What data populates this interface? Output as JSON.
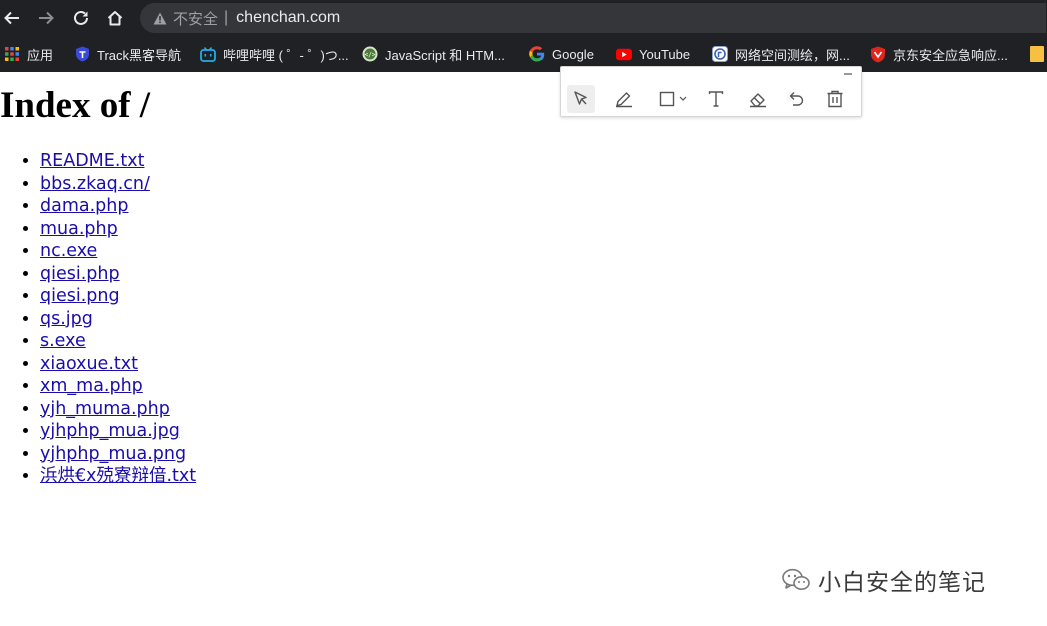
{
  "browser": {
    "url_warning": "不安全",
    "url_separator": "|",
    "url": "chenchan.com"
  },
  "bookmarks": [
    {
      "label": "应用",
      "icon": "apps-grid-icon"
    },
    {
      "label": "Track黑客导航",
      "icon": "shield-badge-icon"
    },
    {
      "label": "哔哩哔哩 ( ゜- ゜)つ...",
      "icon": "bilibili-tv-icon"
    },
    {
      "label": "JavaScript 和 HTM...",
      "icon": "code-globe-icon"
    },
    {
      "label": "Google",
      "icon": "google-g-icon"
    },
    {
      "label": "YouTube",
      "icon": "youtube-play-icon"
    },
    {
      "label": "网络空间测绘，网...",
      "icon": "fofa-icon"
    },
    {
      "label": "京东安全应急响应...",
      "icon": "jd-shield-icon"
    }
  ],
  "annotation_toolbar": {
    "tools": [
      "select-arrow-icon",
      "pen-icon",
      "rectangle-icon",
      "text-tool-icon",
      "eraser-icon",
      "undo-icon",
      "trash-icon"
    ]
  },
  "page": {
    "title": "Index of /",
    "files": [
      "README.txt",
      "bbs.zkaq.cn/",
      "dama.php",
      "mua.php",
      "nc.exe",
      "qiesi.php",
      "qiesi.png",
      "qs.jpg",
      "s.exe",
      "xiaoxue.txt",
      "xm_ma.php",
      "yjh_muma.php",
      "yjhphp_mua.jpg",
      "yjhphp_mua.png",
      "浜烘€х殑寮辩偣.txt"
    ]
  },
  "watermark": {
    "text": "小白安全的笔记"
  }
}
